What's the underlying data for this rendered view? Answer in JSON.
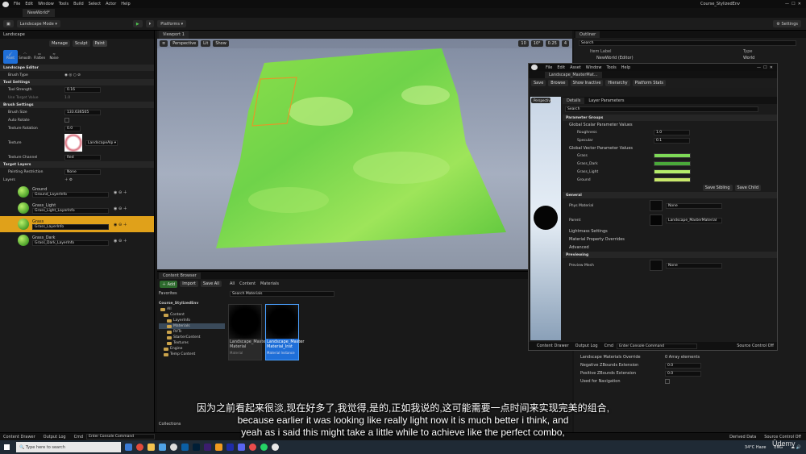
{
  "menubar": {
    "items": [
      "File",
      "Edit",
      "Window",
      "Tools",
      "Build",
      "Select",
      "Actor",
      "Help"
    ],
    "project": "Course_StylizedEnv"
  },
  "tabbar": {
    "level": "NewWorld*"
  },
  "toolbar": {
    "mode": "Landscape Mode",
    "platforms": "Platforms",
    "settings": "Settings"
  },
  "left": {
    "tab": "Landscape",
    "modes": [
      "Manage",
      "Sculpt",
      "Paint"
    ],
    "tools": [
      "Paint",
      "Smooth",
      "Flatten",
      "Noise"
    ],
    "sections": {
      "editor": "Landscape Editor",
      "tool": "Tool Settings",
      "brush": "Brush Settings",
      "target": "Target Layers"
    },
    "brush_type_label": "Brush Type",
    "tool_strength": {
      "label": "Tool Strength",
      "value": "0.16"
    },
    "use_target": {
      "label": "Use Target Value",
      "value": "1.0"
    },
    "brush_size": {
      "label": "Brush Size",
      "value": "133.636505"
    },
    "auto_rotate": "Auto Rotate",
    "tex_rotation": {
      "label": "Texture Rotation",
      "value": "0.0"
    },
    "texture": {
      "label": "Texture",
      "value": "LandscapeAlp"
    },
    "tex_channel": {
      "label": "Texture Channel",
      "value": "Red"
    },
    "paint_restriction": {
      "label": "Painting Restriction",
      "value": "None"
    },
    "layers_label": "Layers",
    "layers": [
      {
        "name": "Ground",
        "info": "Ground_LayerInfo"
      },
      {
        "name": "Grass_Light",
        "info": "Grass_Light_LayerInfo"
      },
      {
        "name": "Grass",
        "info": "Grass_LayerInfo"
      },
      {
        "name": "Grass_Dark",
        "info": "Grass_Dark_LayerInfo"
      }
    ]
  },
  "viewport": {
    "tab": "Viewport 1",
    "buttons": [
      "Perspective",
      "Lit",
      "Show"
    ],
    "stats": [
      "10",
      "10°",
      "0.25",
      "4"
    ]
  },
  "content": {
    "tab": "Content Browser",
    "add": "Add",
    "import": "Import",
    "save_all": "Save All",
    "path": [
      "All",
      "Content",
      "Materials"
    ],
    "search_placeholder": "Search Materials",
    "favorites": "Favorites",
    "project": "Course_StylizedEnv",
    "tree": [
      "All",
      "Content",
      "LayerInfo",
      "Materials",
      "RVTs",
      "StarterContent",
      "Textures",
      "Engine",
      "Temp Content"
    ],
    "collections": "Collections",
    "assets": [
      {
        "name": "Landscape_Master Material",
        "type": "Material"
      },
      {
        "name": "Landscape_Master Material_Inst",
        "type": "Material Instance"
      }
    ]
  },
  "outliner": {
    "tab": "Outliner",
    "search_placeholder": "Search",
    "col_label": "Item Label",
    "col_type": "Type",
    "row": "NewWorld (Editor)",
    "row_type": "World"
  },
  "matwin": {
    "tab": "Landscape_MasterMat...",
    "menu": [
      "File",
      "Edit",
      "Asset",
      "Window",
      "Tools",
      "Help"
    ],
    "toolbar": [
      "Save",
      "Browse",
      "Show Inactive",
      "Hierarchy",
      "Platform Stats"
    ],
    "viewport_btn": "Perspective",
    "panels": [
      "Details",
      "Layer Parameters"
    ],
    "search_placeholder": "Search",
    "param_groups": "Parameter Groups",
    "scalar_group": "Global Scalar Parameter Values",
    "scalars": [
      {
        "name": "Roughness",
        "value": "1.0"
      },
      {
        "name": "Specular",
        "value": "0.1"
      }
    ],
    "vector_group": "Global Vector Parameter Values",
    "vectors": [
      {
        "name": "Grass",
        "color": "#7ed957"
      },
      {
        "name": "Grass_Dark",
        "color": "#4aa83a"
      },
      {
        "name": "Grass_Light",
        "color": "#b4ec6a"
      },
      {
        "name": "Ground",
        "color": "#c8e86a"
      }
    ],
    "save_sibling": "Save Sibling",
    "save_child": "Save Child",
    "general": "General",
    "phys_material": "Phys Material",
    "none": "None",
    "parent": "Parent",
    "parent_value": "Landscape_MasterMaterial",
    "lightmass": "Lightmass Settings",
    "overrides": "Material Property Overrides",
    "advanced": "Advanced",
    "previewing": "Previewing",
    "preview_mesh": "Preview Mesh",
    "content_drawer": "Content Drawer",
    "output_log": "Output Log",
    "cmd": "Cmd",
    "console_placeholder": "Enter Console Command",
    "source_control": "Source Control Off"
  },
  "details_behind": {
    "rows": [
      "Landscape Materials Override",
      "Negative ZBounds Extension",
      "Positive ZBounds Extension",
      "Used for Navigation"
    ],
    "array": "0 Array elements",
    "v1": "0.0",
    "v2": "0.0"
  },
  "status": {
    "content_drawer": "Content Drawer",
    "output_log": "Output Log",
    "cmd": "Cmd",
    "console": "Enter Console Command",
    "derived": "Derived Data",
    "source_control": "Source Control Off"
  },
  "taskbar": {
    "search": "Type here to search",
    "weather": "34°C  Haze",
    "lang": "ENG"
  },
  "subtitles": {
    "zh": "因为之前看起来很淡,现在好多了,我觉得,是的,正如我说的,这可能需要一点时间来实现完美的组合,",
    "en1": "because earlier it was looking like really light now it is much better i think, and",
    "en2": "yeah as i said this might take a little while to achieve like the perfect combo,"
  },
  "watermark": "Ūdemy"
}
